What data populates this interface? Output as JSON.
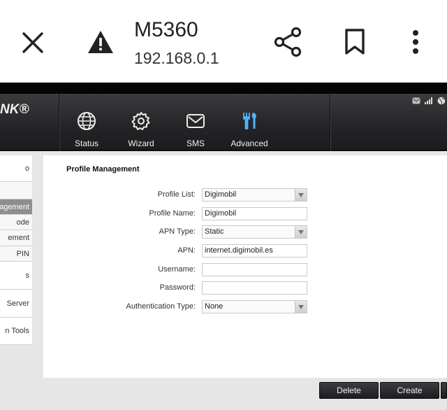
{
  "browser": {
    "title": "M5360",
    "url": "192.168.0.1"
  },
  "router": {
    "brand": "NK®",
    "nav": [
      {
        "label": "Status",
        "icon": "globe-icon"
      },
      {
        "label": "Wizard",
        "icon": "gear-icon"
      },
      {
        "label": "SMS",
        "icon": "envelope-icon"
      },
      {
        "label": "Advanced",
        "icon": "tools-icon"
      }
    ],
    "active_nav": "Advanced"
  },
  "sidebar": {
    "items": [
      {
        "label": "o"
      },
      {
        "label": ""
      },
      {
        "label": "agement"
      },
      {
        "label": "ode"
      },
      {
        "label": "ement"
      },
      {
        "label": "PIN"
      },
      {
        "label": "s"
      },
      {
        "label": "Server"
      },
      {
        "label": "n Tools"
      }
    ],
    "active_index": 2
  },
  "profile": {
    "heading": "Profile Management",
    "fields": [
      {
        "label": "Profile List:",
        "value": "Digimobil",
        "type": "select"
      },
      {
        "label": "Profile Name:",
        "value": "Digimobil",
        "type": "text"
      },
      {
        "label": "APN Type:",
        "value": "Static",
        "type": "select"
      },
      {
        "label": "APN:",
        "value": "internet.digimobil.es",
        "type": "text"
      },
      {
        "label": "Username:",
        "value": "",
        "type": "text"
      },
      {
        "label": "Password:",
        "value": "",
        "type": "password"
      },
      {
        "label": "Authentication Type:",
        "value": "None",
        "type": "select"
      }
    ]
  },
  "buttons": {
    "delete": "Delete",
    "create": "Create"
  },
  "colors": {
    "header_dark": "#232426",
    "accent_active_nav": "#4db3ff",
    "sidebar_active": "#8e8e8e",
    "button_dark": "#2a2b2e"
  }
}
